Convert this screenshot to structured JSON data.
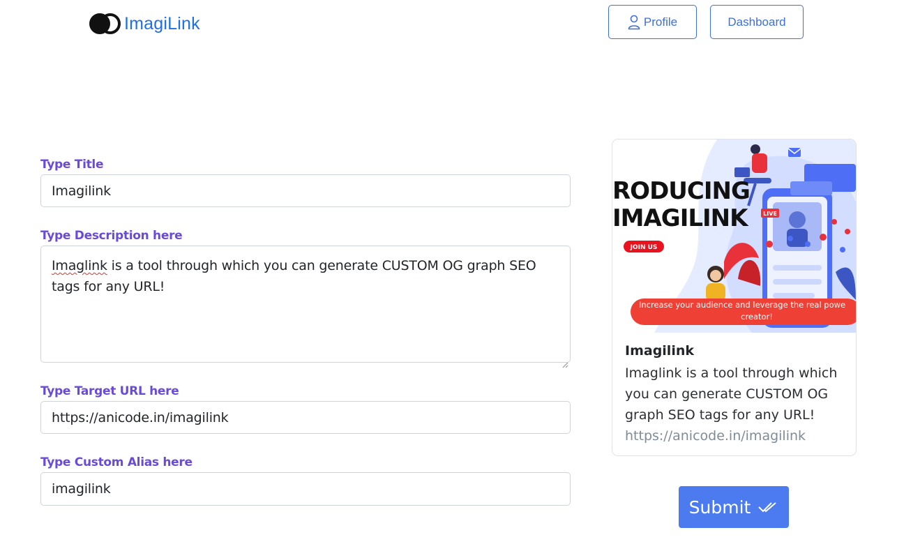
{
  "header": {
    "brand": "ImagiLink",
    "nav": {
      "profile": "Profile",
      "dashboard": "Dashboard"
    }
  },
  "form": {
    "title_label": "Type Title",
    "title_value": "Imagilink",
    "description_label": "Type Description here",
    "description_first_word": "Imaglink",
    "description_rest": " is a tool through which you can generate CUSTOM OG graph SEO tags for any URL!",
    "url_label": "Type Target URL here",
    "url_value": "https://anicode.in/imagilink",
    "alias_label": "Type Custom Alias here",
    "alias_value": "imagilink"
  },
  "preview": {
    "image": {
      "headline_line1": "RODUCING",
      "headline_line2": "IMAGILINK",
      "live_badge": "LIVE",
      "join_badge": "JOIN US",
      "banner_line1": "Increase your audience and leverage the real powe",
      "banner_line2": "creator!"
    },
    "title": "Imagilink",
    "description": "Imaglink is a tool through which you can generate CUSTOM OG graph SEO tags for any URL!",
    "url": "https://anicode.in/imagilink"
  },
  "submit_label": "Submit",
  "colors": {
    "brand": "#1f6fe5",
    "label": "#6a4bd8",
    "outline": "#3d6fd8",
    "submit": "#4c7bf0"
  }
}
